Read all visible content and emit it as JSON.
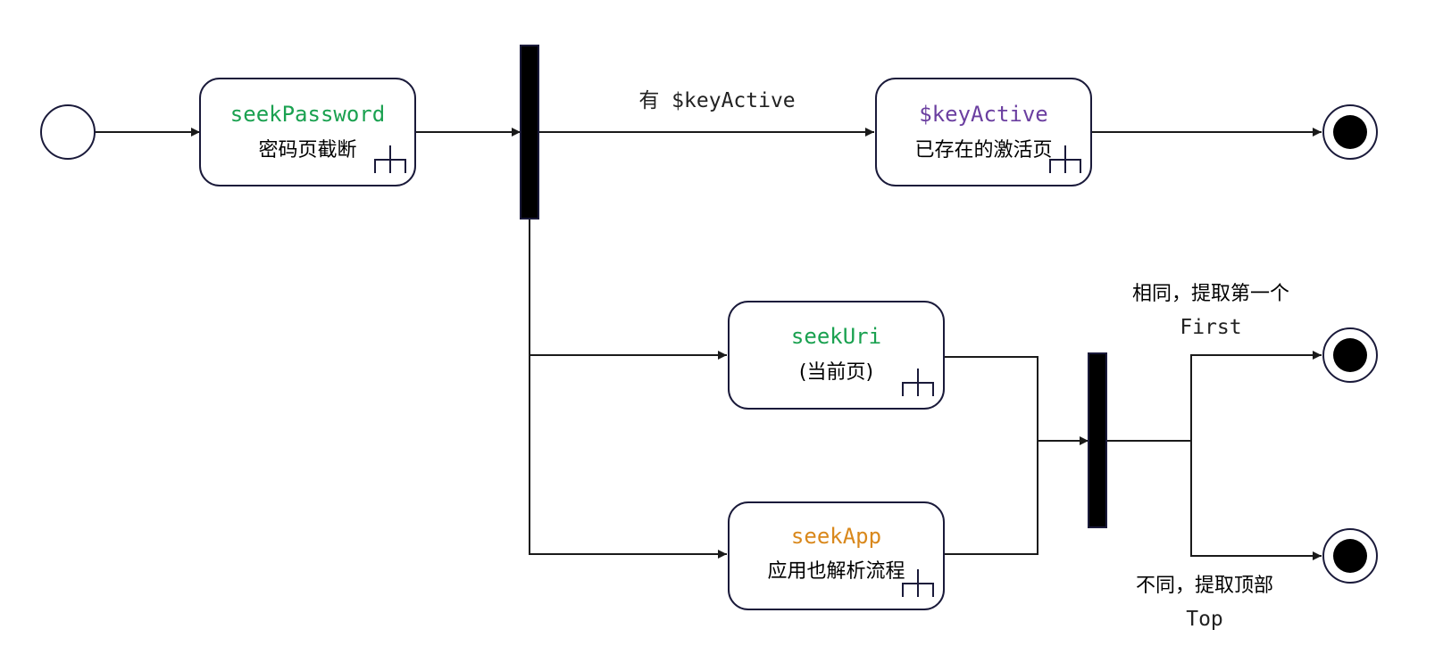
{
  "colors": {
    "green": "#1aa150",
    "purple": "#6b3fa0",
    "orange": "#d9881c"
  },
  "nodes": {
    "seek_password": {
      "code": "seekPassword",
      "text": "密码页截断",
      "color": "#1aa150",
      "icon": "subactivity-rake-icon"
    },
    "key_active": {
      "code": "$keyActive",
      "text": "已存在的激活页",
      "color": "#6b3fa0",
      "icon": "subactivity-rake-icon"
    },
    "seek_uri": {
      "code": "seekUri",
      "text": "(当前页)",
      "color": "#1aa150",
      "icon": "subactivity-rake-icon"
    },
    "seek_app": {
      "code": "seekApp",
      "text": "应用也解析流程",
      "color": "#d9881c",
      "icon": "subactivity-rake-icon"
    }
  },
  "edge_labels": {
    "has_key_active": "有 $keyActive",
    "same_line1": "相同，提取第一个",
    "same_line2": "First",
    "diff_line1": "不同，提取顶部",
    "diff_line2": "Top"
  }
}
